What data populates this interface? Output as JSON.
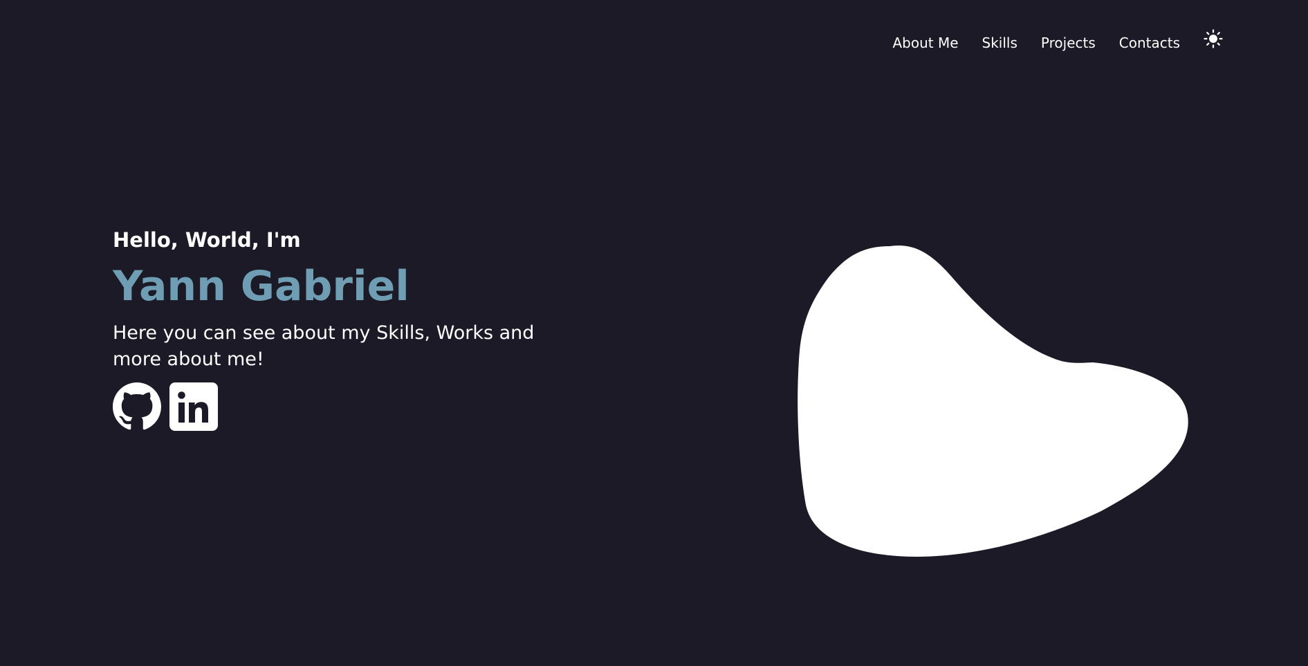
{
  "nav": {
    "links": [
      {
        "label": "About Me"
      },
      {
        "label": "Skills"
      },
      {
        "label": "Projects"
      },
      {
        "label": "Contacts"
      }
    ],
    "theme_toggle_icon": "sun-icon"
  },
  "hero": {
    "greeting": "Hello, World, I'm",
    "name": "Yann Gabriel",
    "tagline": "Here you can see about my Skills, Works and more about me!",
    "socials": [
      {
        "icon": "github-icon"
      },
      {
        "icon": "linkedin-icon"
      }
    ]
  },
  "colors": {
    "background": "#1b1a26",
    "accent": "#6f9db3",
    "text": "#ffffff"
  }
}
